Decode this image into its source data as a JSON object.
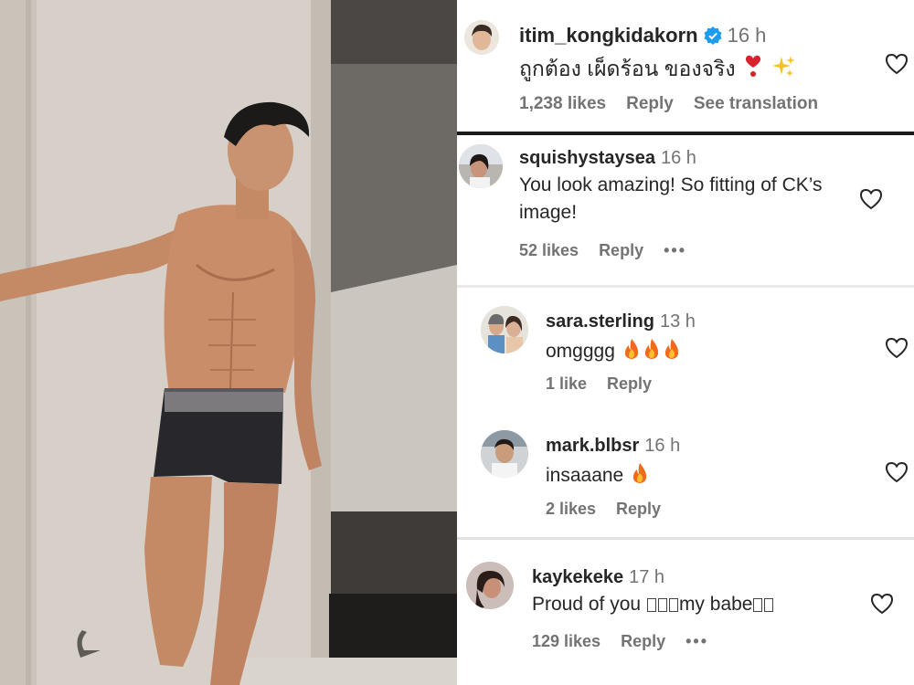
{
  "comments": [
    {
      "username": "itim_kongkidakorn",
      "time": "16 h",
      "verified": true,
      "text": "ถูกต้อง เผ็ดร้อน ของจริง",
      "emojis": [
        "heart-exclamation-emoji",
        "sparkles-emoji"
      ],
      "likes": "1,238 likes",
      "reply": "Reply",
      "translate": "See translation"
    },
    {
      "username": "squishystaysea",
      "time": "16 h",
      "text_line1": "You look amazing! So fitting of CK’s",
      "text_line2": "image!",
      "likes": "52 likes",
      "reply": "Reply",
      "more": "•••"
    },
    {
      "username": "sara.sterling",
      "time": "13 h",
      "text": "omgggg",
      "emojis": [
        "fire-emoji",
        "fire-emoji",
        "fire-emoji"
      ],
      "likes": "1 like",
      "reply": "Reply"
    },
    {
      "username": "mark.blbsr",
      "time": "16 h",
      "text": "insaaane",
      "emojis": [
        "fire-emoji"
      ],
      "likes": "2 likes",
      "reply": "Reply"
    },
    {
      "username": "kaykekeke",
      "time": "17 h",
      "text_a": "Proud of you",
      "text_b": "my babe",
      "likes": "129 likes",
      "reply": "Reply",
      "more": "•••"
    }
  ],
  "colors": {
    "text": "#262626",
    "muted": "#737373",
    "verified": "#1d9bf0",
    "fire": "#f26a1b"
  }
}
